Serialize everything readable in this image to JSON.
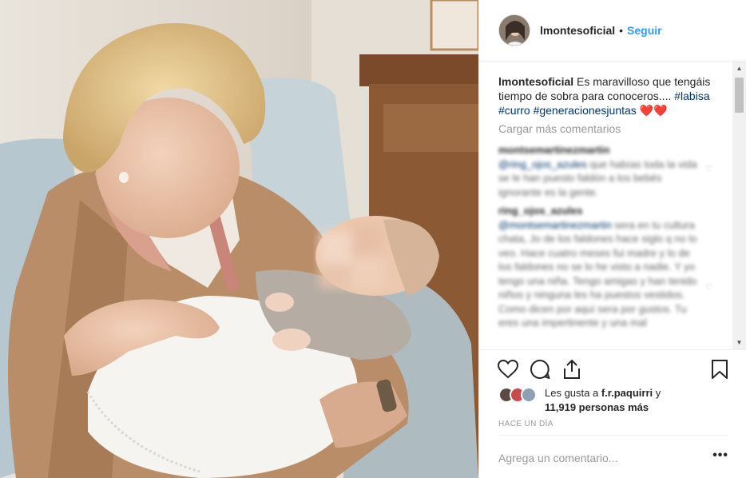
{
  "post": {
    "username": "lmontesoficial",
    "follow_label": "Seguir",
    "separator": "•"
  },
  "caption": {
    "username": "lmontesoficial",
    "text": "Es maravilloso que tengáis tiempo de sobra para conoceros....",
    "tags": [
      "#labisa",
      "#curro",
      "#generacionesjuntas"
    ],
    "emoji": "❤️❤️"
  },
  "comments": {
    "load_more_label": "Cargar más comentarios",
    "items": [
      {
        "username": "montsemartinezmartin",
        "mention": "@ring_ojos_azules",
        "text": "que habías toda la vida se le han puesto faldón a los bebés ignorante es la gente."
      },
      {
        "username": "ring_ojos_azules",
        "mention": "@montsemartinezmartin",
        "text": "sera en tu cultura chata, Jo de los faldones hace siglo q no lo veo. Hace cuatro meses fui madre y lo de los faldones no se lo he visto a nadie. Y yo tengo una niña. Tengo amigas y han tenido niños y ninguna les ha puestos vestidos. Como dicen por aquí sera por gustos. Tu eres una impertinente y una mal"
      }
    ]
  },
  "likes": {
    "text_prefix": "Les gusta a",
    "liker": "f.r.paquirri",
    "conjunction": "y",
    "count": "11,919",
    "suffix": "personas más"
  },
  "timestamp": "HACE UN DÍA",
  "add_comment": {
    "placeholder": "Agrega un comentario...",
    "more_label": "•••"
  },
  "icons": {
    "like": "heart-outline-icon",
    "comment": "comment-bubble-icon",
    "share": "share-icon",
    "save": "bookmark-icon"
  },
  "colors": {
    "link": "#3897f0",
    "hashtag": "#003569",
    "muted": "#999999"
  }
}
